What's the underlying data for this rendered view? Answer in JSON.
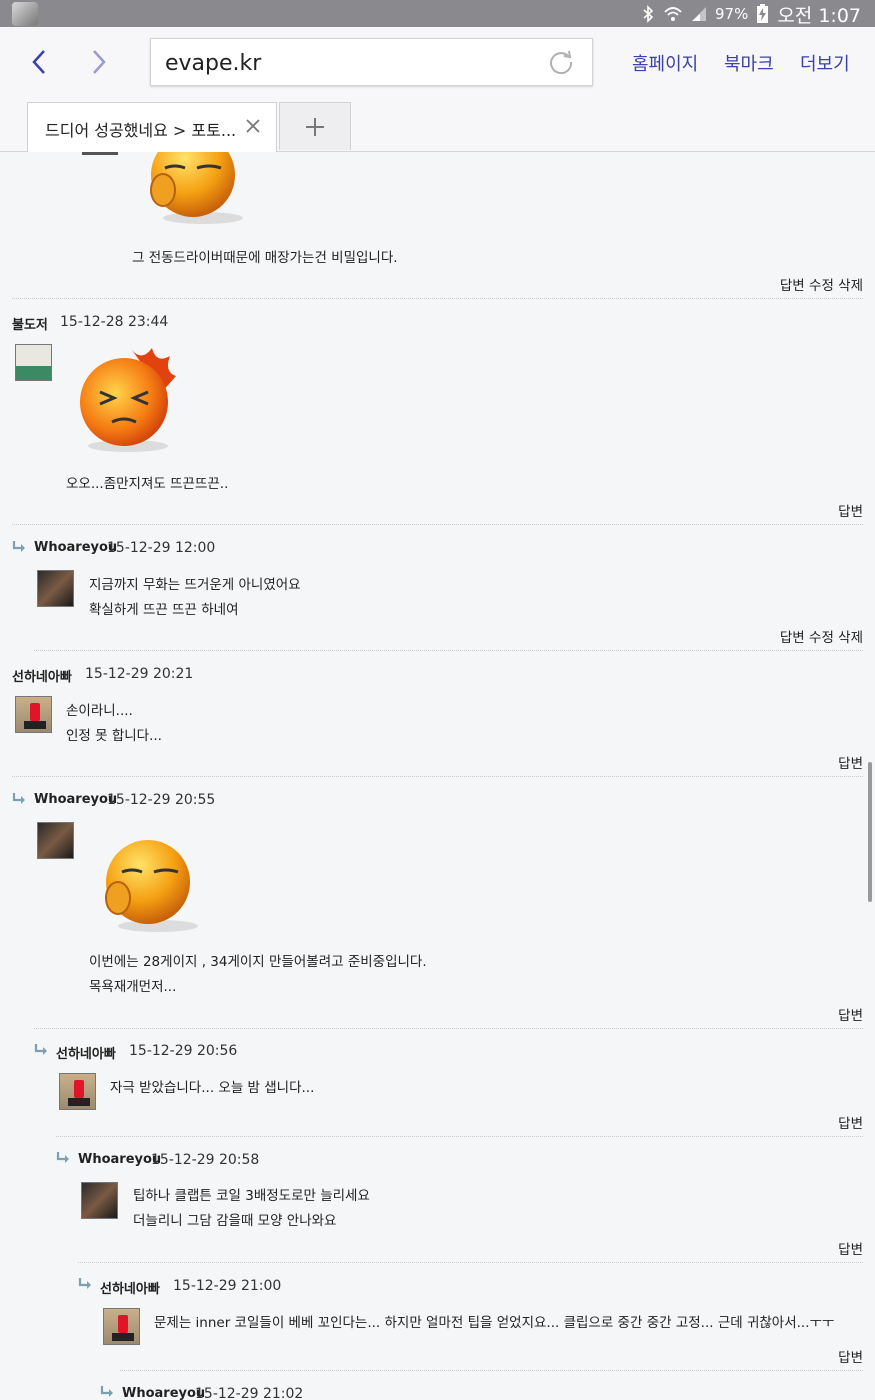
{
  "status_bar": {
    "battery": "97%",
    "time": "오전 1:07"
  },
  "browser": {
    "url": "evape.kr",
    "links": {
      "home": "홈페이지",
      "bookmark": "북마크",
      "more": "더보기"
    },
    "tab_title": "드디어 성공했네요 > 포토..."
  },
  "comments": [
    {
      "text_lines": [
        "그 전동드라이버때문에 매장가는건 비밀입니다."
      ],
      "actions": "답변 수정 삭제"
    },
    {
      "author": "불도저",
      "date": "15-12-28 23:44",
      "text_lines": [
        "오오...좀만지져도 뜨끈뜨끈.."
      ],
      "actions": "답변"
    },
    {
      "author": "Whoareyou",
      "date": "15-12-29 12:00",
      "text_lines": [
        "지금까지 무화는 뜨거운게 아니였어요",
        "확실하게 뜨끈 뜨끈 하네여"
      ],
      "actions": "답변 수정 삭제"
    },
    {
      "author": "선하네아빠",
      "date": "15-12-29 20:21",
      "text_lines": [
        "손이라니....",
        "인정 못 합니다..."
      ],
      "actions": "답변"
    },
    {
      "author": "Whoareyou",
      "date": "15-12-29 20:55",
      "text_lines": [
        "이번에는 28게이지 , 34게이지 만들어볼려고 준비중입니다.",
        "목욕재개먼저..."
      ],
      "actions": "답변"
    },
    {
      "author": "선하네아빠",
      "date": "15-12-29 20:56",
      "text_lines": [
        "자극 받았습니다... 오늘 밤 샙니다..."
      ],
      "actions": "답변"
    },
    {
      "author": "Whoareyou",
      "date": "15-12-29 20:58",
      "text_lines": [
        "팁하나 클랩튼 코일 3배정도로만 늘리세요",
        "더늘리니 그담 감을때 모양 안나와요"
      ],
      "actions": "답변"
    },
    {
      "author": "선하네아빠",
      "date": "15-12-29 21:00",
      "text_lines": [
        "문제는 inner 코일들이 베베 꼬인다는... 하지만 얼마전 팁을 얻었지요... 클립으로 중간 중간 고정... 근데 귀찮아서...ㅜㅜ"
      ],
      "actions": "답변"
    },
    {
      "author": "Whoareyou",
      "date": "15-12-29 21:02"
    }
  ],
  "colors": {
    "link": "#3b41a8",
    "status_bar": "#8a8a8e",
    "page_bg": "#f4f6f7"
  }
}
